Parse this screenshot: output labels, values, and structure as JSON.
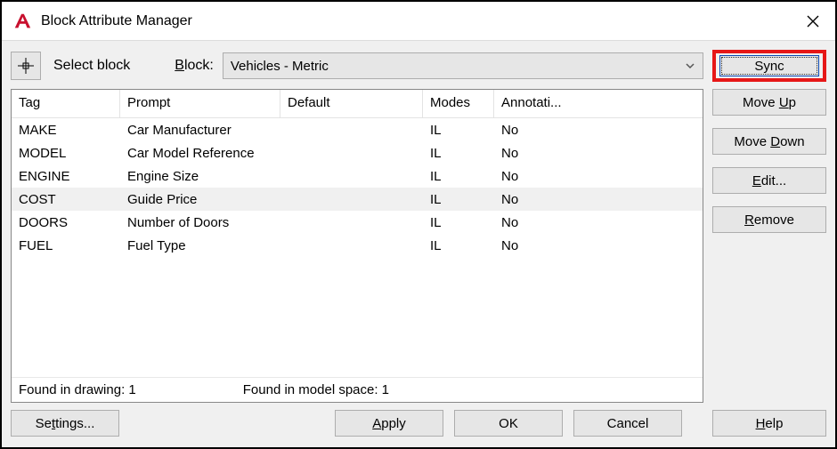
{
  "title": "Block Attribute Manager",
  "toprow": {
    "select_block_label": "Select block",
    "block_label": "Block:",
    "block_value": "Vehicles - Metric",
    "sync_label": "Sync"
  },
  "columns": {
    "tag": "Tag",
    "prompt": "Prompt",
    "default": "Default",
    "modes": "Modes",
    "annotative": "Annotati..."
  },
  "rows": [
    {
      "tag": "MAKE",
      "prompt": "Car Manufacturer",
      "default": "",
      "modes": "IL",
      "annotative": "No",
      "selected": false
    },
    {
      "tag": "MODEL",
      "prompt": "Car Model Reference",
      "default": "",
      "modes": "IL",
      "annotative": "No",
      "selected": false
    },
    {
      "tag": "ENGINE",
      "prompt": "Engine Size",
      "default": "",
      "modes": "IL",
      "annotative": "No",
      "selected": false
    },
    {
      "tag": "COST",
      "prompt": "Guide Price",
      "default": "",
      "modes": "IL",
      "annotative": "No",
      "selected": true
    },
    {
      "tag": "DOORS",
      "prompt": "Number of Doors",
      "default": "",
      "modes": "IL",
      "annotative": "No",
      "selected": false
    },
    {
      "tag": "FUEL",
      "prompt": "Fuel Type",
      "default": "",
      "modes": "IL",
      "annotative": "No",
      "selected": false
    }
  ],
  "status": {
    "found_drawing": "Found in drawing: 1",
    "found_model": "Found in model space: 1"
  },
  "side": {
    "move_up": "Move Up",
    "move_down": "Move Down",
    "edit": "Edit...",
    "remove": "Remove"
  },
  "bottom": {
    "settings": "Settings...",
    "apply": "Apply",
    "ok": "OK",
    "cancel": "Cancel",
    "help": "Help"
  }
}
